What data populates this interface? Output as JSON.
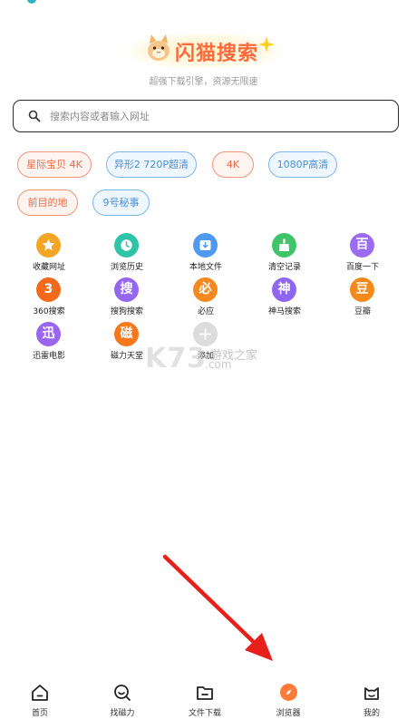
{
  "header": {
    "logo_text": "闪猫搜索",
    "tagline": "超强下载引擎，资源无限速"
  },
  "search": {
    "placeholder": "搜索内容或者输入网址"
  },
  "hot_tags": [
    {
      "label": "星际宝贝 4K",
      "style": "orange"
    },
    {
      "label": "异形2 720P超清",
      "style": "blue"
    },
    {
      "label": "4K",
      "style": "orange"
    },
    {
      "label": "1080P高清",
      "style": "blue"
    },
    {
      "label": "前目的地",
      "style": "orange"
    },
    {
      "label": "9号秘事",
      "style": "blue"
    }
  ],
  "shortcuts": [
    {
      "label": "收藏网址",
      "icon": "star-icon",
      "glyph": "",
      "color": "#f5a524"
    },
    {
      "label": "浏览历史",
      "icon": "clock-icon",
      "glyph": "",
      "color": "#2ec4a8"
    },
    {
      "label": "本地文件",
      "icon": "download-folder-icon",
      "glyph": "",
      "color": "#4f9af0"
    },
    {
      "label": "清空记录",
      "icon": "broom-icon",
      "glyph": "",
      "color": "#3fc46a"
    },
    {
      "label": "百度一下",
      "icon": "baidu-icon",
      "glyph": "百",
      "color": "#9b6cf0"
    },
    {
      "label": "360搜索",
      "icon": "360-icon",
      "glyph": "3",
      "color": "#f36a1c"
    },
    {
      "label": "搜狗搜索",
      "icon": "sogou-icon",
      "glyph": "搜",
      "color": "#9566f0"
    },
    {
      "label": "必应",
      "icon": "bing-icon",
      "glyph": "必",
      "color": "#f5891f"
    },
    {
      "label": "神马搜索",
      "icon": "shenma-icon",
      "glyph": "神",
      "color": "#8f66f0"
    },
    {
      "label": "豆瓣",
      "icon": "douban-icon",
      "glyph": "豆",
      "color": "#f58a1c"
    },
    {
      "label": "迅雷电影",
      "icon": "xunlei-icon",
      "glyph": "迅",
      "color": "#9a66f0"
    },
    {
      "label": "磁力天堂",
      "icon": "magnet-icon",
      "glyph": "磁",
      "color": "#f5781c"
    },
    {
      "label": "添加",
      "icon": "add-icon",
      "glyph": "+",
      "color": "#d8d8d8"
    }
  ],
  "watermark": {
    "logo": "K73",
    "line1": "游戏之家",
    "line2": ".com"
  },
  "tabbar": [
    {
      "label": "首页",
      "icon": "home-icon"
    },
    {
      "label": "找磁力",
      "icon": "magnet-search-icon"
    },
    {
      "label": "文件下载",
      "icon": "file-download-icon"
    },
    {
      "label": "浏览器",
      "icon": "browser-compass-icon"
    },
    {
      "label": "我的",
      "icon": "cat-profile-icon"
    }
  ],
  "colors": {
    "accent": "#ff7b3a",
    "chip_orange": "#ee6a45",
    "chip_blue": "#4a90d9",
    "arrow": "#e8201c"
  }
}
